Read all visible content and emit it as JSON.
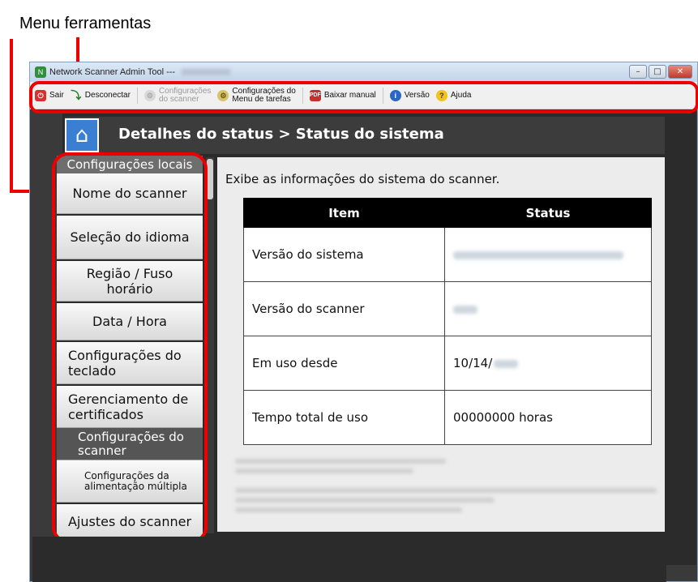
{
  "callout": {
    "label": "Menu ferramentas"
  },
  "window": {
    "title": "Network Scanner Admin Tool ---"
  },
  "toolbar": {
    "items": [
      {
        "label": "Sair",
        "icon": "exit-icon"
      },
      {
        "label": "Desconectar",
        "icon": "disconnect-icon"
      },
      {
        "label": "Configurações\ndo scanner",
        "icon": "gear-icon",
        "disabled": true
      },
      {
        "label": "Configurações do\nMenu de tarefas",
        "icon": "gear-icon"
      },
      {
        "label": "Baixar manual",
        "icon": "pdf-icon"
      },
      {
        "label": "Versão",
        "icon": "info-icon"
      },
      {
        "label": "Ajuda",
        "icon": "help-icon"
      }
    ]
  },
  "header": {
    "breadcrumb": "Detalhes do status > Status do sistema"
  },
  "sidebar": {
    "section": "Configurações locais",
    "items": [
      "Nome do scanner",
      "Seleção do idioma",
      "Região / Fuso horário",
      "Data / Hora",
      "Configurações do teclado",
      "Gerenciamento de certificados",
      "Configurações do scanner",
      "Configurações da alimentação múltipla",
      "Ajustes do scanner"
    ]
  },
  "main": {
    "description": "Exibe as informações do sistema do scanner.",
    "table": {
      "headers": [
        "Item",
        "Status"
      ],
      "rows": [
        {
          "item": "Versão do sistema",
          "status": ""
        },
        {
          "item": "Versão do scanner",
          "status": ""
        },
        {
          "item": "Em uso desde",
          "status": "10/14/"
        },
        {
          "item": "Tempo total de uso",
          "status": "00000000 horas"
        }
      ]
    }
  },
  "colors": {
    "highlight": "#e00000",
    "accent": "#3b7fd3",
    "header_bg": "#000000"
  }
}
